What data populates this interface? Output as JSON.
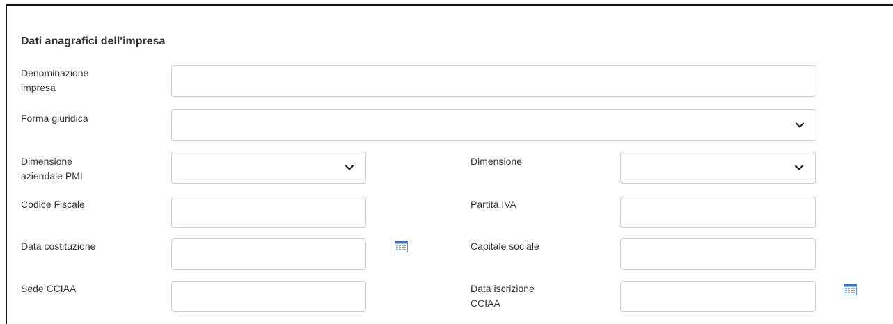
{
  "section": {
    "title": "Dati anagrafici dell'impresa"
  },
  "fields": {
    "denominazione": {
      "label_line1": "Denominazione",
      "label_line2": "impresa",
      "value": ""
    },
    "forma_giuridica": {
      "label": "Forma giuridica",
      "selected": ""
    },
    "dimensione_pmi": {
      "label_line1": "Dimensione",
      "label_line2": "aziendale PMI",
      "selected": ""
    },
    "dimensione": {
      "label": "Dimensione",
      "selected": ""
    },
    "codice_fiscale": {
      "label": "Codice Fiscale",
      "value": ""
    },
    "partita_iva": {
      "label": "Partita IVA",
      "value": ""
    },
    "data_costituzione": {
      "label": "Data costituzione",
      "value": ""
    },
    "capitale_sociale": {
      "label": "Capitale sociale",
      "value": ""
    },
    "sede_cciaa": {
      "label": "Sede CCIAA",
      "value": ""
    },
    "data_iscrizione": {
      "label_line1": "Data iscrizione",
      "label_line2": "CCIAA",
      "value": ""
    }
  },
  "icons": {
    "select_arrow": "chevron-down-icon",
    "date_picker": "calendar-icon"
  },
  "colors": {
    "border": "#cccccc",
    "text": "#333333",
    "frame": "#111111"
  }
}
